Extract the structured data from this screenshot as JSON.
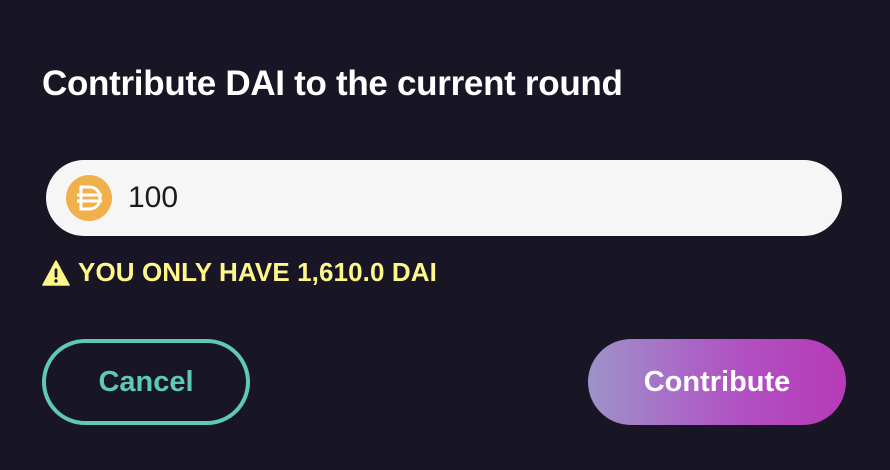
{
  "modal": {
    "title": "Contribute DAI to the current round"
  },
  "amount": {
    "token_icon": "dai-token-icon",
    "value": "100"
  },
  "warning": {
    "icon": "warning-triangle-icon",
    "text": "YOU ONLY HAVE 1,610.0 DAI",
    "color": "#fff78a"
  },
  "actions": {
    "cancel_label": "Cancel",
    "contribute_label": "Contribute"
  },
  "colors": {
    "background": "#181624",
    "cancel_accent": "#5ec9b4",
    "dai_token": "#f4b731",
    "contribute_gradient_start": "#9d92c9",
    "contribute_gradient_end": "#b73ab6"
  }
}
